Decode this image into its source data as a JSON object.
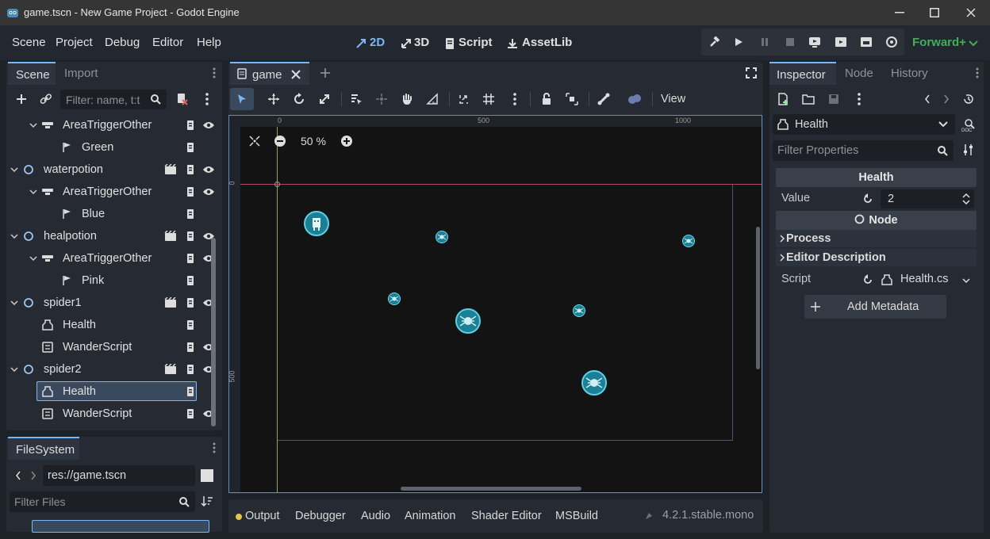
{
  "window": {
    "title": "game.tscn - New Game Project - Godot Engine"
  },
  "menu": [
    "Scene",
    "Project",
    "Debug",
    "Editor",
    "Help"
  ],
  "workspaces": {
    "2d": "2D",
    "3d": "3D",
    "script": "Script",
    "assetlib": "AssetLib"
  },
  "renderer": "Forward+",
  "scene_dock": {
    "tabs": [
      "Scene",
      "Import"
    ],
    "filter_placeholder": "Filter: name, t:t",
    "tree": [
      {
        "label": "AreaTriggerOther",
        "icon": "area-icon"
      },
      {
        "label": "Green",
        "icon": "flag-icon"
      },
      {
        "label": "waterpotion",
        "icon": "node-circle-icon"
      },
      {
        "label": "AreaTriggerOther",
        "icon": "area-icon"
      },
      {
        "label": "Blue",
        "icon": "flag-icon"
      },
      {
        "label": "healpotion",
        "icon": "node-circle-icon"
      },
      {
        "label": "AreaTriggerOther",
        "icon": "area-icon"
      },
      {
        "label": "Pink",
        "icon": "flag-icon"
      },
      {
        "label": "spider1",
        "icon": "node-circle-icon"
      },
      {
        "label": "Health",
        "icon": "health-icon"
      },
      {
        "label": "WanderScript",
        "icon": "script-node-icon"
      },
      {
        "label": "spider2",
        "icon": "node-circle-icon"
      },
      {
        "label": "Health",
        "icon": "health-icon",
        "selected": true
      },
      {
        "label": "WanderScript",
        "icon": "script-node-icon"
      }
    ]
  },
  "filesystem": {
    "title": "FileSystem",
    "path": "res://game.tscn",
    "filter_placeholder": "Filter Files"
  },
  "editor": {
    "tab": "game",
    "view_label": "View",
    "zoom": "50 %",
    "ruler_top": [
      "0",
      "500",
      "1000"
    ],
    "ruler_left": [
      "0",
      "500"
    ]
  },
  "bottom": {
    "tabs": [
      "Output",
      "Debugger",
      "Audio",
      "Animation",
      "Shader Editor",
      "MSBuild"
    ],
    "version": "4.2.1.stable.mono"
  },
  "inspector": {
    "tabs": [
      "Inspector",
      "Node",
      "History"
    ],
    "object": "Health",
    "filter_placeholder": "Filter Properties",
    "section_title": "Health",
    "value_label": "Value",
    "value": "2",
    "node_section": "Node",
    "process": "Process",
    "editor_description": "Editor Description",
    "script_label": "Script",
    "script_value": "Health.cs",
    "add_metadata": "Add Metadata"
  },
  "colors": {
    "accent": "#7cb7f5",
    "renderer": "#45ad5a",
    "selection": "#3a4a5e",
    "output_dot": "#e6c54a"
  }
}
